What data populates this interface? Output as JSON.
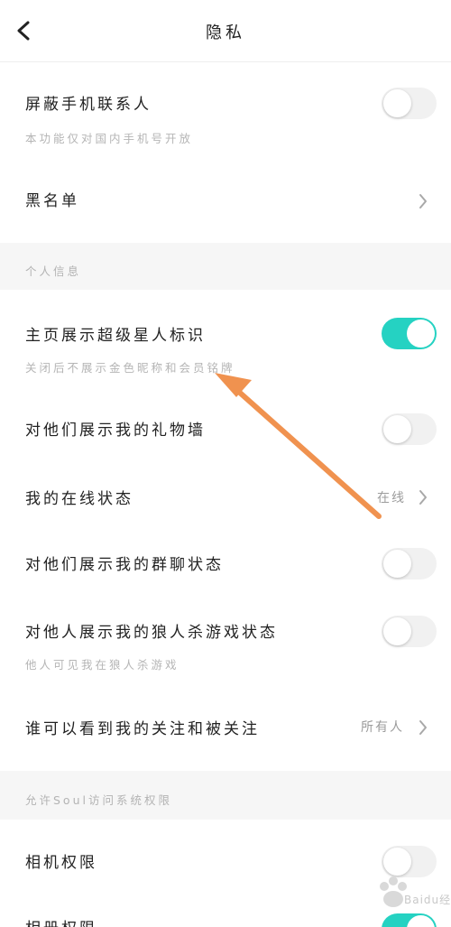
{
  "header": {
    "title": "隐私"
  },
  "rows": {
    "block_contacts": {
      "title": "屏蔽手机联系人",
      "subtitle": "本功能仅对国内手机号开放",
      "toggle_on": false
    },
    "blacklist": {
      "title": "黑名单"
    },
    "badge": {
      "title": "主页展示超级星人标识",
      "subtitle": "关闭后不展示金色昵称和会员铭牌",
      "toggle_on": true
    },
    "gift_wall": {
      "title": "对他们展示我的礼物墙",
      "toggle_on": false
    },
    "online_status": {
      "title": "我的在线状态",
      "value": "在线"
    },
    "group_chat": {
      "title": "对他们展示我的群聊状态",
      "toggle_on": false
    },
    "werewolf": {
      "title": "对他人展示我的狼人杀游戏状态",
      "subtitle": "他人可见我在狼人杀游戏",
      "toggle_on": false
    },
    "follow_visibility": {
      "title": "谁可以看到我的关注和被关注",
      "value": "所有人"
    },
    "camera": {
      "title": "相机权限",
      "toggle_on": false
    },
    "album": {
      "title": "相册权限",
      "toggle_on": true
    }
  },
  "sections": {
    "personal_info": "个人信息",
    "system_permissions": "允许Soul访问系统权限"
  },
  "watermark": {
    "text": "Baidu经验"
  },
  "colors": {
    "toggle_on": "#25d2c2",
    "arrow": "#f0924f"
  }
}
